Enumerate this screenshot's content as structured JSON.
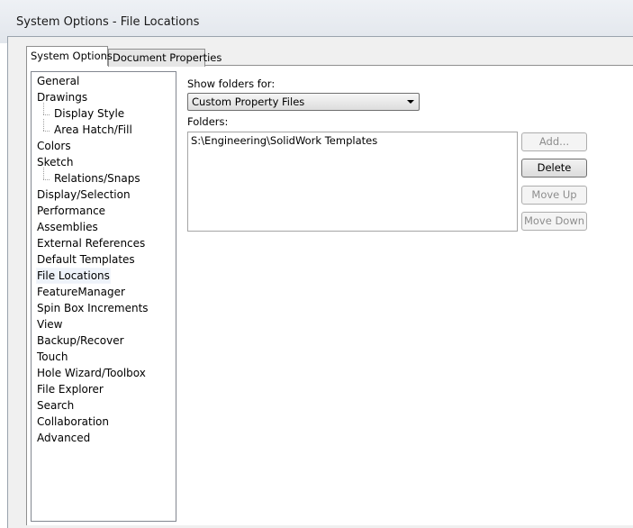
{
  "window": {
    "title": "System Options - File Locations"
  },
  "tabs": [
    {
      "label": "System Options",
      "active": true
    },
    {
      "label": "Document Properties",
      "active": false
    }
  ],
  "nav": {
    "selected": "File Locations",
    "items": [
      {
        "label": "General",
        "level": 0
      },
      {
        "label": "Drawings",
        "level": 0
      },
      {
        "label": "Display Style",
        "level": 1
      },
      {
        "label": "Area Hatch/Fill",
        "level": 1
      },
      {
        "label": "Colors",
        "level": 0
      },
      {
        "label": "Sketch",
        "level": 0
      },
      {
        "label": "Relations/Snaps",
        "level": 1
      },
      {
        "label": "Display/Selection",
        "level": 0
      },
      {
        "label": "Performance",
        "level": 0
      },
      {
        "label": "Assemblies",
        "level": 0
      },
      {
        "label": "External References",
        "level": 0
      },
      {
        "label": "Default Templates",
        "level": 0
      },
      {
        "label": "File Locations",
        "level": 0
      },
      {
        "label": "FeatureManager",
        "level": 0
      },
      {
        "label": "Spin Box Increments",
        "level": 0
      },
      {
        "label": "View",
        "level": 0
      },
      {
        "label": "Backup/Recover",
        "level": 0
      },
      {
        "label": "Touch",
        "level": 0
      },
      {
        "label": "Hole Wizard/Toolbox",
        "level": 0
      },
      {
        "label": "File Explorer",
        "level": 0
      },
      {
        "label": "Search",
        "level": 0
      },
      {
        "label": "Collaboration",
        "level": 0
      },
      {
        "label": "Advanced",
        "level": 0
      }
    ]
  },
  "main": {
    "show_folders_label": "Show folders for:",
    "show_folders_value": "Custom Property Files",
    "folders_label": "Folders:",
    "folders": [
      "S:\\Engineering\\SolidWork Templates"
    ],
    "buttons": {
      "add": {
        "label": "Add...",
        "enabled": false
      },
      "delete": {
        "label": "Delete",
        "enabled": true
      },
      "move_up": {
        "label": "Move Up",
        "enabled": false
      },
      "move_down": {
        "label": "Move Down",
        "enabled": false
      }
    }
  }
}
